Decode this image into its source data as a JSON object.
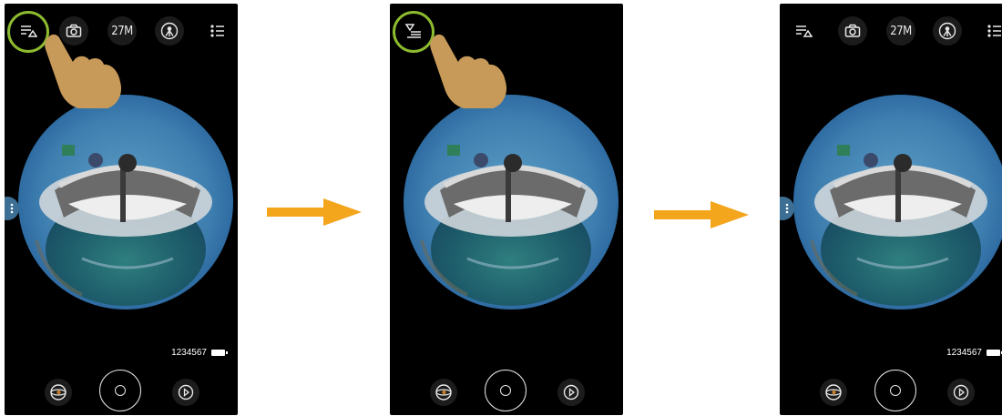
{
  "screens": [
    {
      "resolution": "27M",
      "counter": "1234567",
      "show_counter": true,
      "highlighted": true,
      "mode": "normal"
    },
    {
      "resolution": "",
      "counter": "",
      "show_counter": false,
      "highlighted": true,
      "mode": "hidden"
    },
    {
      "resolution": "27M",
      "counter": "1234567",
      "show_counter": true,
      "highlighted": false,
      "mode": "normal"
    }
  ],
  "colors": {
    "highlight_ring": "#8dbb2f",
    "arrow": "#f3a51c",
    "hand": "#c79a5a"
  },
  "icons": [
    "display-toggle-icon",
    "camera-icon",
    "tripod-mode-icon",
    "settings-list-icon",
    "globe-view-icon",
    "shutter-icon",
    "playback-icon",
    "more-options-icon",
    "pointing-hand-icon",
    "right-arrow-icon"
  ]
}
